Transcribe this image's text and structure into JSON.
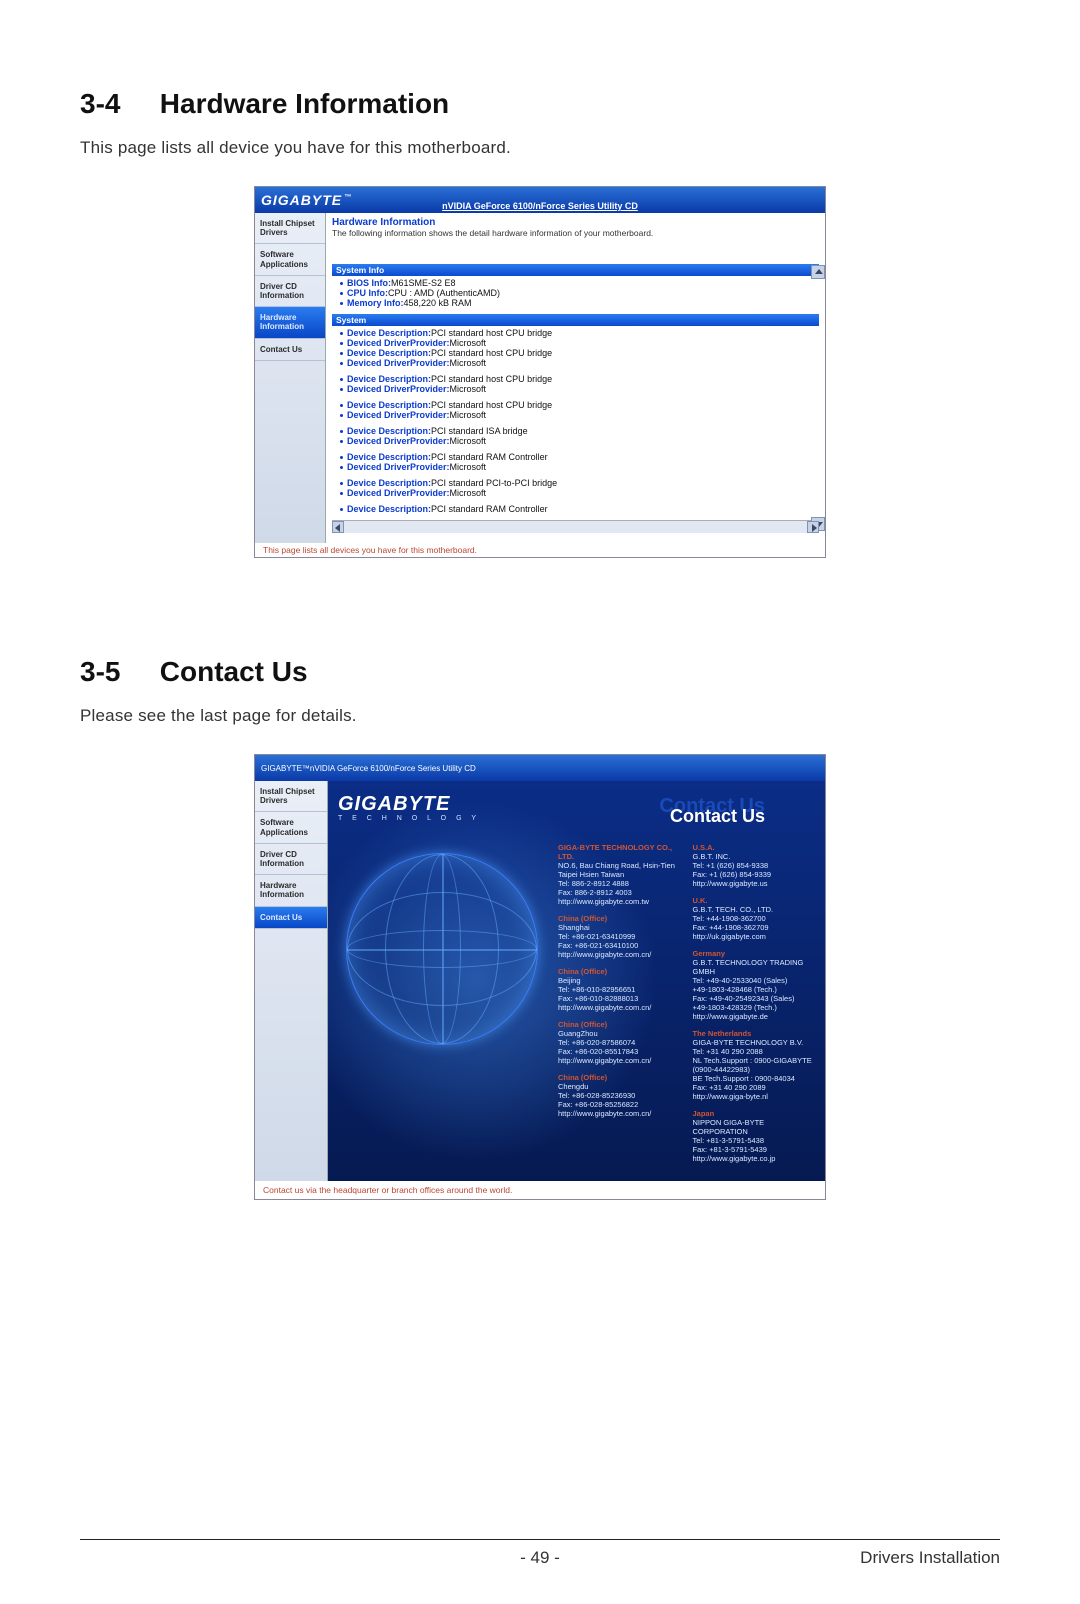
{
  "section1": {
    "num": "3-4",
    "title": "Hardware Information",
    "intro": "This page lists all device you have for this motherboard."
  },
  "section2": {
    "num": "3-5",
    "title": "Contact Us",
    "intro": "Please see the last page for details."
  },
  "app": {
    "brand": "GIGABYTE",
    "tm": "™",
    "subtitle": "nVIDIA GeForce 6100/nForce Series Utility CD",
    "nav": {
      "install": "Install\nChipset Drivers",
      "software": "Software\nApplications",
      "drivercd": "Driver CD\nInformation",
      "hardware": "Hardware\nInformation",
      "contact": "Contact Us"
    }
  },
  "hw": {
    "title": "Hardware Information",
    "desc": "The following information shows the detail hardware information of your motherboard.",
    "sys_hdr": "System Info",
    "sys": {
      "bios_l": "BIOS Info:",
      "bios_v": "M61SME-S2 E8",
      "cpu_l": "CPU Info:",
      "cpu_v": "CPU : AMD (AuthenticAMD)",
      "mem_l": "Memory Info:",
      "mem_v": "458,220 kB RAM"
    },
    "sys2_hdr": "System",
    "dd_l": "Device Description:",
    "dp_l": "Deviced DriverProvider:",
    "dp_v": "Microsoft",
    "v_cpu": "PCI standard host CPU bridge",
    "v_isa": "PCI standard ISA bridge",
    "v_ram": "PCI standard RAM Controller",
    "v_p2p": "PCI standard PCI-to-PCI bridge",
    "caption": "This page lists all devices you have for this motherboard."
  },
  "contact": {
    "bigbrand": "GIGABYTE",
    "tagline": "T E C H N O L O G Y",
    "heading_shadow": "Contact Us",
    "heading": "Contact Us",
    "caption": "Contact us via the headquarter or branch offices around the world.",
    "left": [
      {
        "head": "GIGA-BYTE TECHNOLOGY CO., LTD.",
        "lines": [
          "NO.6, Bau Chiang Road, Hsin-Tien",
          "Taipei Hsien Taiwan",
          "Tel: 886-2-8912 4888",
          "Fax: 886-2-8912 4003",
          "http://www.gigabyte.com.tw"
        ]
      },
      {
        "head": "China (Office)",
        "lines": [
          "Shanghai",
          "Tel: +86-021-63410999",
          "Fax: +86-021-63410100",
          "http://www.gigabyte.com.cn/"
        ]
      },
      {
        "head": "China (Office)",
        "lines": [
          "Beijing",
          "Tel: +86-010-82956651",
          "Fax: +86-010-82888013",
          "http://www.gigabyte.com.cn/"
        ]
      },
      {
        "head": "China (Office)",
        "lines": [
          "GuangZhou",
          "Tel: +86-020-87586074",
          "Fax: +86-020-85517843",
          "http://www.gigabyte.com.cn/"
        ]
      },
      {
        "head": "China (Office)",
        "lines": [
          "Chengdu",
          "Tel: +86-028-85236930",
          "Fax: +86-028-85256822",
          "http://www.gigabyte.com.cn/"
        ]
      }
    ],
    "right": [
      {
        "head": "U.S.A.",
        "lines": [
          "G.B.T. INC.",
          "Tel: +1 (626) 854-9338",
          "Fax: +1 (626) 854-9339",
          "http://www.gigabyte.us"
        ]
      },
      {
        "head": "U.K.",
        "lines": [
          "G.B.T. TECH. CO., LTD.",
          "Tel: +44-1908-362700",
          "Fax: +44-1908-362709",
          "http://uk.gigabyte.com"
        ]
      },
      {
        "head": "Germany",
        "lines": [
          "G.B.T. TECHNOLOGY TRADING GMBH",
          "Tel: +49-40-2533040 (Sales)",
          "+49-1803-428468 (Tech.)",
          "Fax: +49-40-25492343 (Sales)",
          "+49-1803-428329 (Tech.)",
          "http://www.gigabyte.de"
        ]
      },
      {
        "head": "The Netherlands",
        "lines": [
          "GIGA-BYTE TECHNOLOGY B.V.",
          "Tel: +31 40 290 2088",
          "NL Tech.Support : 0900-GIGABYTE (0900-44422983)",
          "BE Tech.Support : 0900-84034",
          "Fax: +31 40 290 2089",
          "http://www.giga-byte.nl"
        ]
      },
      {
        "head": "Japan",
        "lines": [
          "NIPPON GIGA-BYTE CORPORATION",
          "Tel: +81-3-5791-5438",
          "Fax: +81-3-5791-5439",
          "http://www.gigabyte.co.jp"
        ]
      }
    ]
  },
  "footer": {
    "page": "- 49 -",
    "right": "Drivers Installation"
  }
}
